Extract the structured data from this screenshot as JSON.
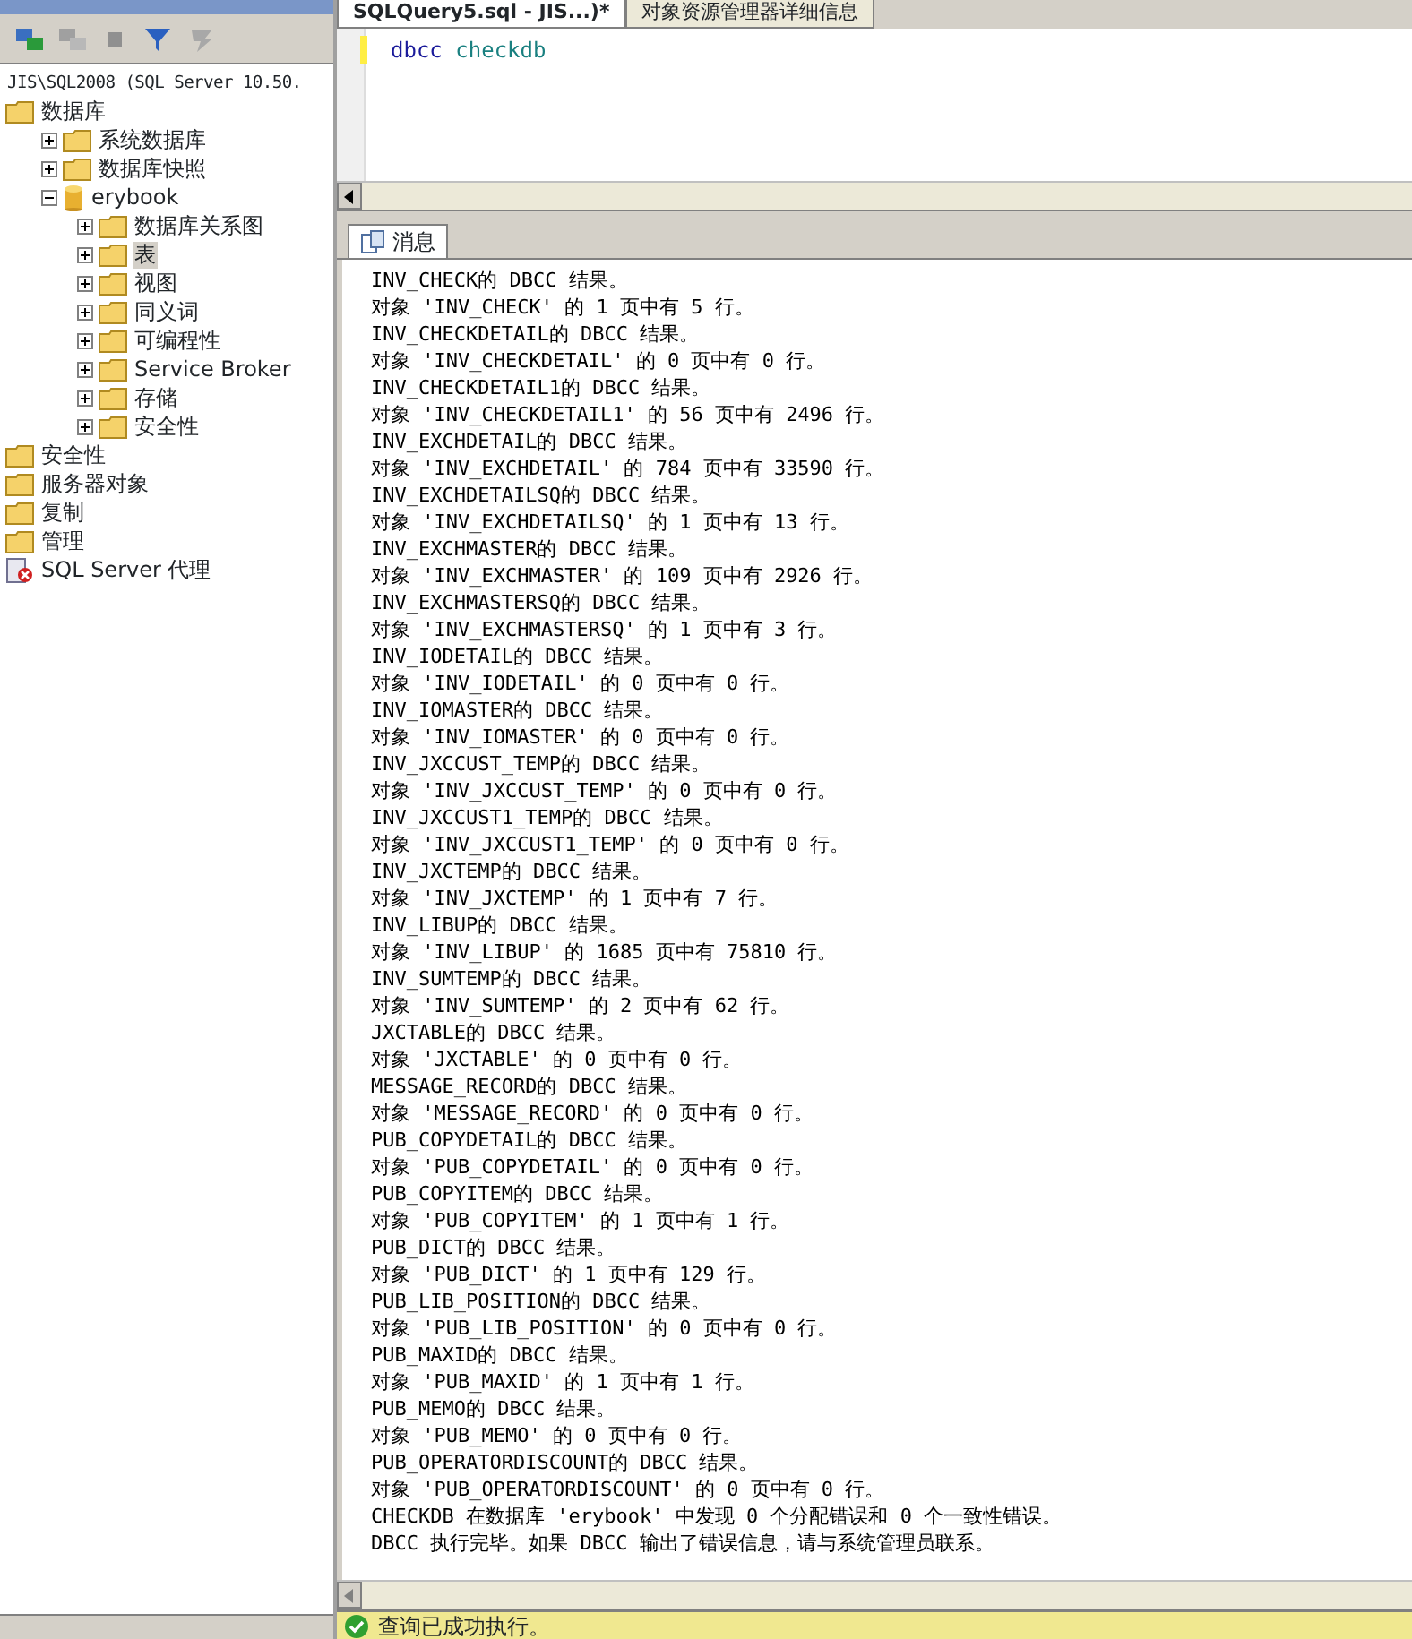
{
  "object_explorer": {
    "tree": [
      {
        "label": "JIS\\SQL2008 (SQL Server 10.50.",
        "kind": "server",
        "selected": false,
        "children": [
          {
            "label": "数据库",
            "kind": "folder",
            "selected": false,
            "children": [
              {
                "label": "系统数据库",
                "kind": "folder",
                "expanded": false,
                "selected": false
              },
              {
                "label": "数据库快照",
                "kind": "folder",
                "expanded": false,
                "selected": false
              },
              {
                "label": "erybook",
                "kind": "database",
                "expanded": true,
                "selected": false,
                "children": [
                  {
                    "label": "数据库关系图",
                    "kind": "folder",
                    "expanded": false,
                    "selected": false
                  },
                  {
                    "label": "表",
                    "kind": "folder",
                    "expanded": false,
                    "selected": true
                  },
                  {
                    "label": "视图",
                    "kind": "folder",
                    "expanded": false,
                    "selected": false
                  },
                  {
                    "label": "同义词",
                    "kind": "folder",
                    "expanded": false,
                    "selected": false
                  },
                  {
                    "label": "可编程性",
                    "kind": "folder",
                    "expanded": false,
                    "selected": false
                  },
                  {
                    "label": "Service Broker",
                    "kind": "folder",
                    "expanded": false,
                    "selected": false
                  },
                  {
                    "label": "存储",
                    "kind": "folder",
                    "expanded": false,
                    "selected": false
                  },
                  {
                    "label": "安全性",
                    "kind": "folder",
                    "expanded": false,
                    "selected": false
                  }
                ]
              }
            ]
          },
          {
            "label": "安全性",
            "kind": "folder",
            "selected": false
          },
          {
            "label": "服务器对象",
            "kind": "folder",
            "selected": false
          },
          {
            "label": "复制",
            "kind": "folder",
            "selected": false
          },
          {
            "label": "管理",
            "kind": "folder",
            "selected": false
          },
          {
            "label": "SQL Server 代理",
            "kind": "agent",
            "selected": false
          }
        ]
      }
    ]
  },
  "editor_tabs": [
    {
      "label": "SQLQuery5.sql - JIS...)*",
      "selected": true
    },
    {
      "label": "对象资源管理器详细信息",
      "selected": false
    }
  ],
  "query": [
    {
      "text": "dbcc",
      "kind": "keyword"
    },
    {
      "text": "checkdb",
      "kind": "function"
    }
  ],
  "results_tabs": [
    {
      "label": "消息",
      "selected": true
    }
  ],
  "messages": [
    "INV_CHECK的 DBCC 结果。",
    "对象 'INV_CHECK' 的 1 页中有 5 行。",
    "INV_CHECKDETAIL的 DBCC 结果。",
    "对象 'INV_CHECKDETAIL' 的 0 页中有 0 行。",
    "INV_CHECKDETAIL1的 DBCC 结果。",
    "对象 'INV_CHECKDETAIL1' 的 56 页中有 2496 行。",
    "INV_EXCHDETAIL的 DBCC 结果。",
    "对象 'INV_EXCHDETAIL' 的 784 页中有 33590 行。",
    "INV_EXCHDETAILSQ的 DBCC 结果。",
    "对象 'INV_EXCHDETAILSQ' 的 1 页中有 13 行。",
    "INV_EXCHMASTER的 DBCC 结果。",
    "对象 'INV_EXCHMASTER' 的 109 页中有 2926 行。",
    "INV_EXCHMASTERSQ的 DBCC 结果。",
    "对象 'INV_EXCHMASTERSQ' 的 1 页中有 3 行。",
    "INV_IODETAIL的 DBCC 结果。",
    "对象 'INV_IODETAIL' 的 0 页中有 0 行。",
    "INV_IOMASTER的 DBCC 结果。",
    "对象 'INV_IOMASTER' 的 0 页中有 0 行。",
    "INV_JXCCUST_TEMP的 DBCC 结果。",
    "对象 'INV_JXCCUST_TEMP' 的 0 页中有 0 行。",
    "INV_JXCCUST1_TEMP的 DBCC 结果。",
    "对象 'INV_JXCCUST1_TEMP' 的 0 页中有 0 行。",
    "INV_JXCTEMP的 DBCC 结果。",
    "对象 'INV_JXCTEMP' 的 1 页中有 7 行。",
    "INV_LIBUP的 DBCC 结果。",
    "对象 'INV_LIBUP' 的 1685 页中有 75810 行。",
    "INV_SUMTEMP的 DBCC 结果。",
    "对象 'INV_SUMTEMP' 的 2 页中有 62 行。",
    "JXCTABLE的 DBCC 结果。",
    "对象 'JXCTABLE' 的 0 页中有 0 行。",
    "MESSAGE_RECORD的 DBCC 结果。",
    "对象 'MESSAGE_RECORD' 的 0 页中有 0 行。",
    "PUB_COPYDETAIL的 DBCC 结果。",
    "对象 'PUB_COPYDETAIL' 的 0 页中有 0 行。",
    "PUB_COPYITEM的 DBCC 结果。",
    "对象 'PUB_COPYITEM' 的 1 页中有 1 行。",
    "PUB_DICT的 DBCC 结果。",
    "对象 'PUB_DICT' 的 1 页中有 129 行。",
    "PUB_LIB_POSITION的 DBCC 结果。",
    "对象 'PUB_LIB_POSITION' 的 0 页中有 0 行。",
    "PUB_MAXID的 DBCC 结果。",
    "对象 'PUB_MAXID' 的 1 页中有 1 行。",
    "PUB_MEMO的 DBCC 结果。",
    "对象 'PUB_MEMO' 的 0 页中有 0 行。",
    "PUB_OPERATORDISCOUNT的 DBCC 结果。",
    "对象 'PUB_OPERATORDISCOUNT' 的 0 页中有 0 行。",
    "CHECKDB 在数据库 'erybook' 中发现 0 个分配错误和 0 个一致性错误。",
    "DBCC 执行完毕。如果 DBCC 输出了错误信息，请与系统管理员联系。"
  ],
  "status_bar": {
    "text": "查询已成功执行。"
  }
}
